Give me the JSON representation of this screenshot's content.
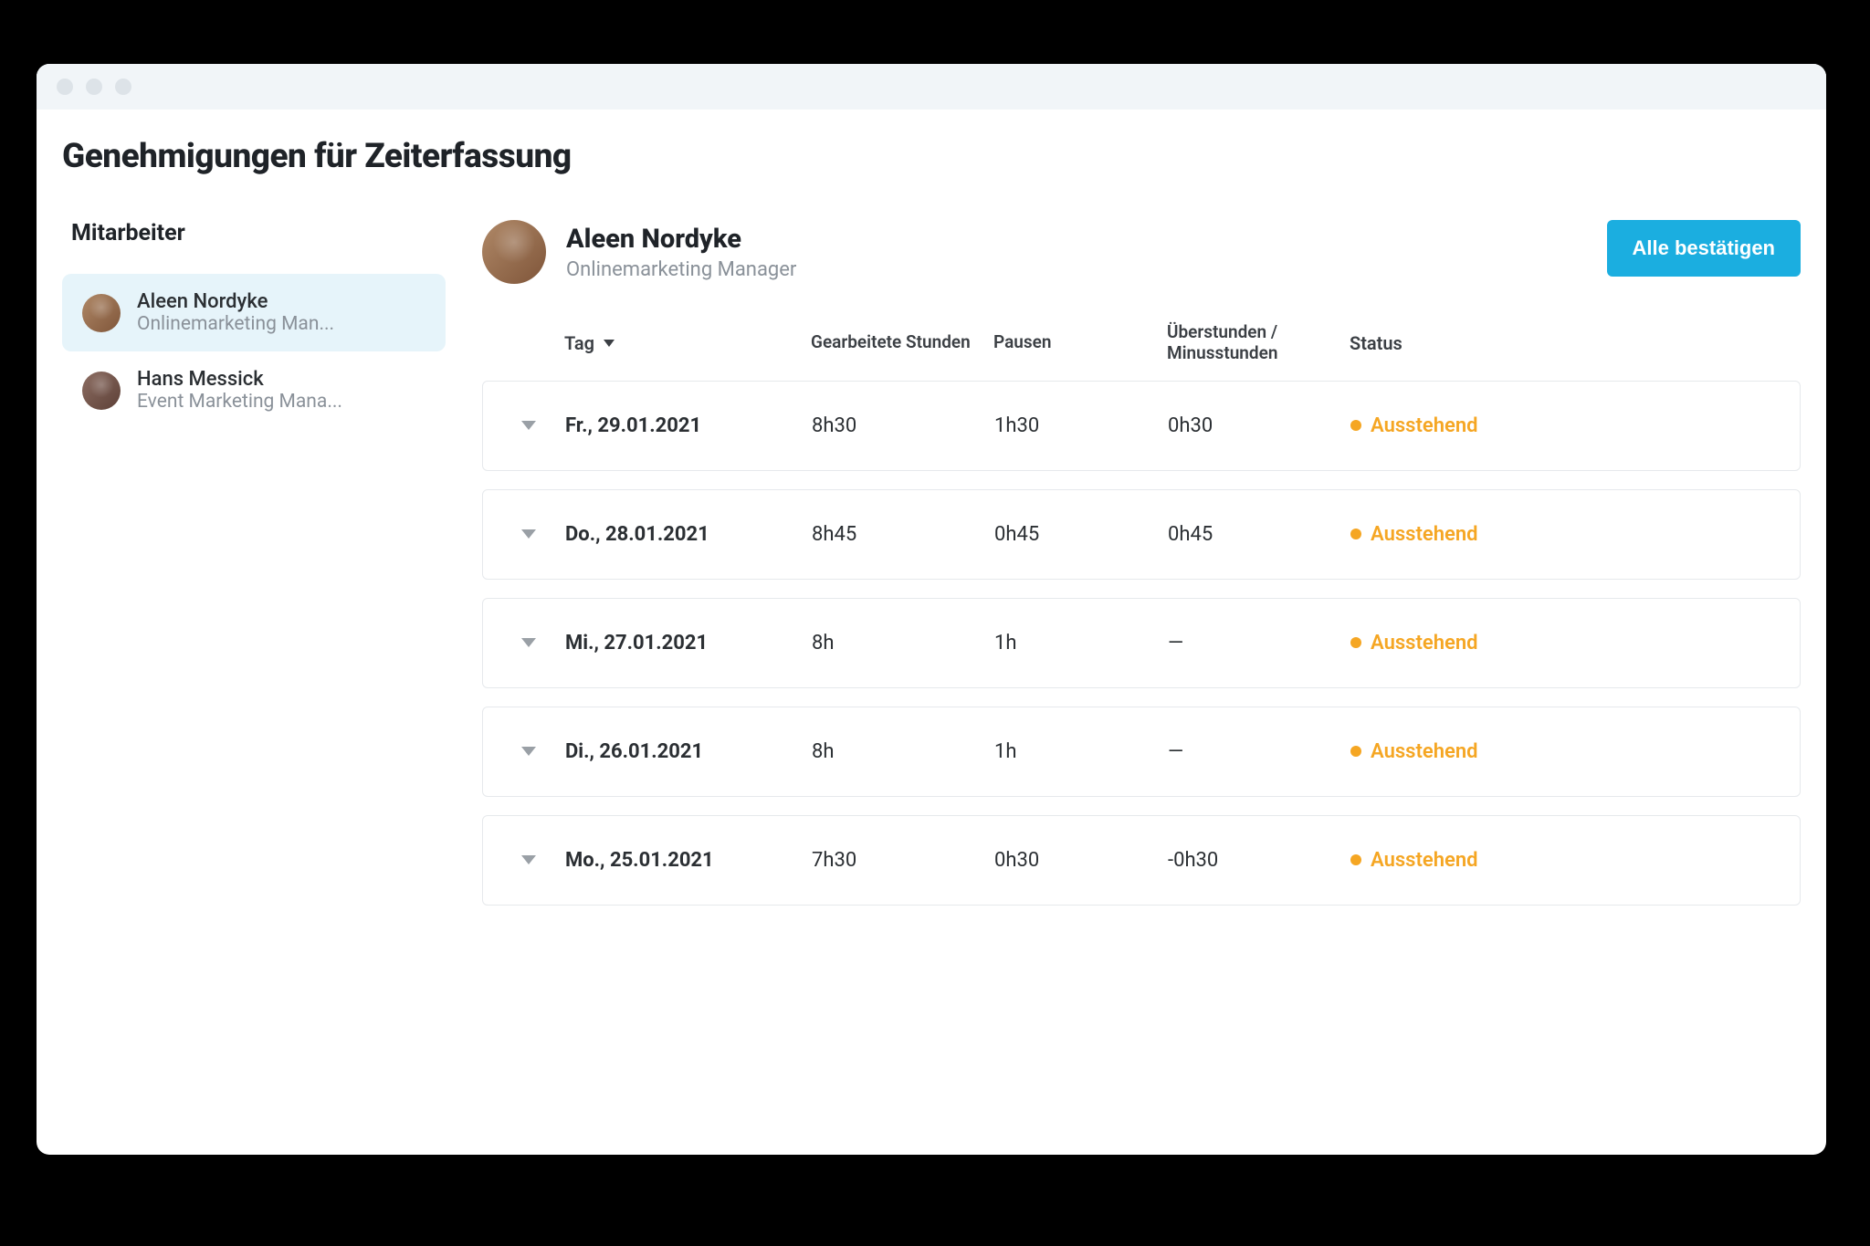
{
  "page_title": "Genehmigungen für Zeiterfassung",
  "sidebar": {
    "heading": "Mitarbeiter",
    "employees": [
      {
        "name": "Aleen Nordyke",
        "role": "Onlinemarketing Man...",
        "selected": true
      },
      {
        "name": "Hans Messick",
        "role": "Event Marketing Mana...",
        "selected": false
      }
    ]
  },
  "detail": {
    "name": "Aleen Nordyke",
    "role": "Onlinemarketing Manager",
    "confirm_all_label": "Alle bestätigen"
  },
  "table": {
    "columns": {
      "day": "Tag",
      "worked": "Gearbeitete Stunden",
      "breaks": "Pausen",
      "overtime": "Überstunden / Minusstunden",
      "status": "Status"
    },
    "rows": [
      {
        "day": "Fr., 29.01.2021",
        "worked": "8h30",
        "breaks": "1h30",
        "overtime": "0h30",
        "status": "Ausstehend"
      },
      {
        "day": "Do., 28.01.2021",
        "worked": "8h45",
        "breaks": "0h45",
        "overtime": "0h45",
        "status": "Ausstehend"
      },
      {
        "day": "Mi., 27.01.2021",
        "worked": "8h",
        "breaks": "1h",
        "overtime": "—",
        "status": "Ausstehend"
      },
      {
        "day": "Di., 26.01.2021",
        "worked": "8h",
        "breaks": "1h",
        "overtime": "—",
        "status": "Ausstehend"
      },
      {
        "day": "Mo., 25.01.2021",
        "worked": "7h30",
        "breaks": "0h30",
        "overtime": "-0h30",
        "status": "Ausstehend"
      }
    ]
  },
  "colors": {
    "accent": "#1baee0",
    "pending": "#f5a623",
    "selected_bg": "#e6f4fa"
  }
}
